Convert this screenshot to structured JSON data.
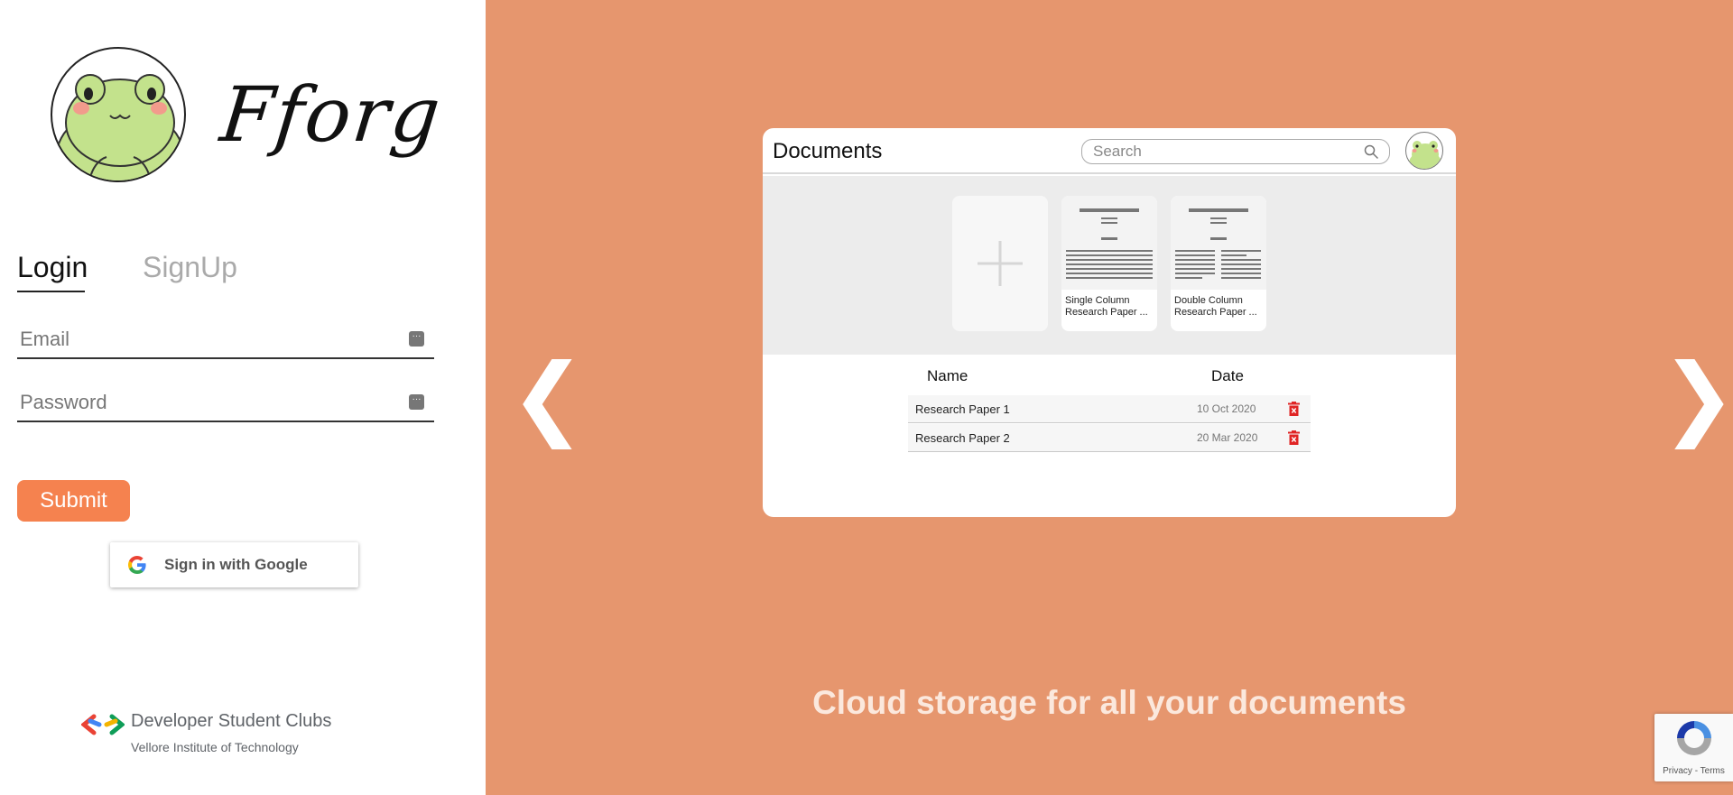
{
  "brand": {
    "name": "Fforg"
  },
  "auth": {
    "tabs": {
      "login": "Login",
      "signup": "SignUp"
    },
    "email_placeholder": "Email",
    "password_placeholder": "Password",
    "submit_label": "Submit",
    "google_label": "Sign in with Google"
  },
  "footer": {
    "org": "Developer Student Clubs",
    "institute": "Vellore Institute of Technology"
  },
  "carousel": {
    "prev_symbol": "❮",
    "next_symbol": "❯",
    "caption": "Cloud storage for all your documents",
    "background": "#e6966e"
  },
  "preview": {
    "title": "Documents",
    "search_placeholder": "Search",
    "templates": [
      {
        "label": ""
      },
      {
        "label": "Single Column Research Paper ..."
      },
      {
        "label": "Double Column Research Paper ..."
      }
    ],
    "table": {
      "headers": {
        "name": "Name",
        "date": "Date"
      },
      "rows": [
        {
          "name": "Research Paper 1",
          "date": "10 Oct 2020"
        },
        {
          "name": "Research Paper 2",
          "date": "20 Mar 2020"
        }
      ]
    }
  },
  "recaptcha": {
    "terms": "Privacy - Terms"
  },
  "colors": {
    "accent": "#f5824f",
    "panel": "#e6966e",
    "delete": "#e02424"
  }
}
